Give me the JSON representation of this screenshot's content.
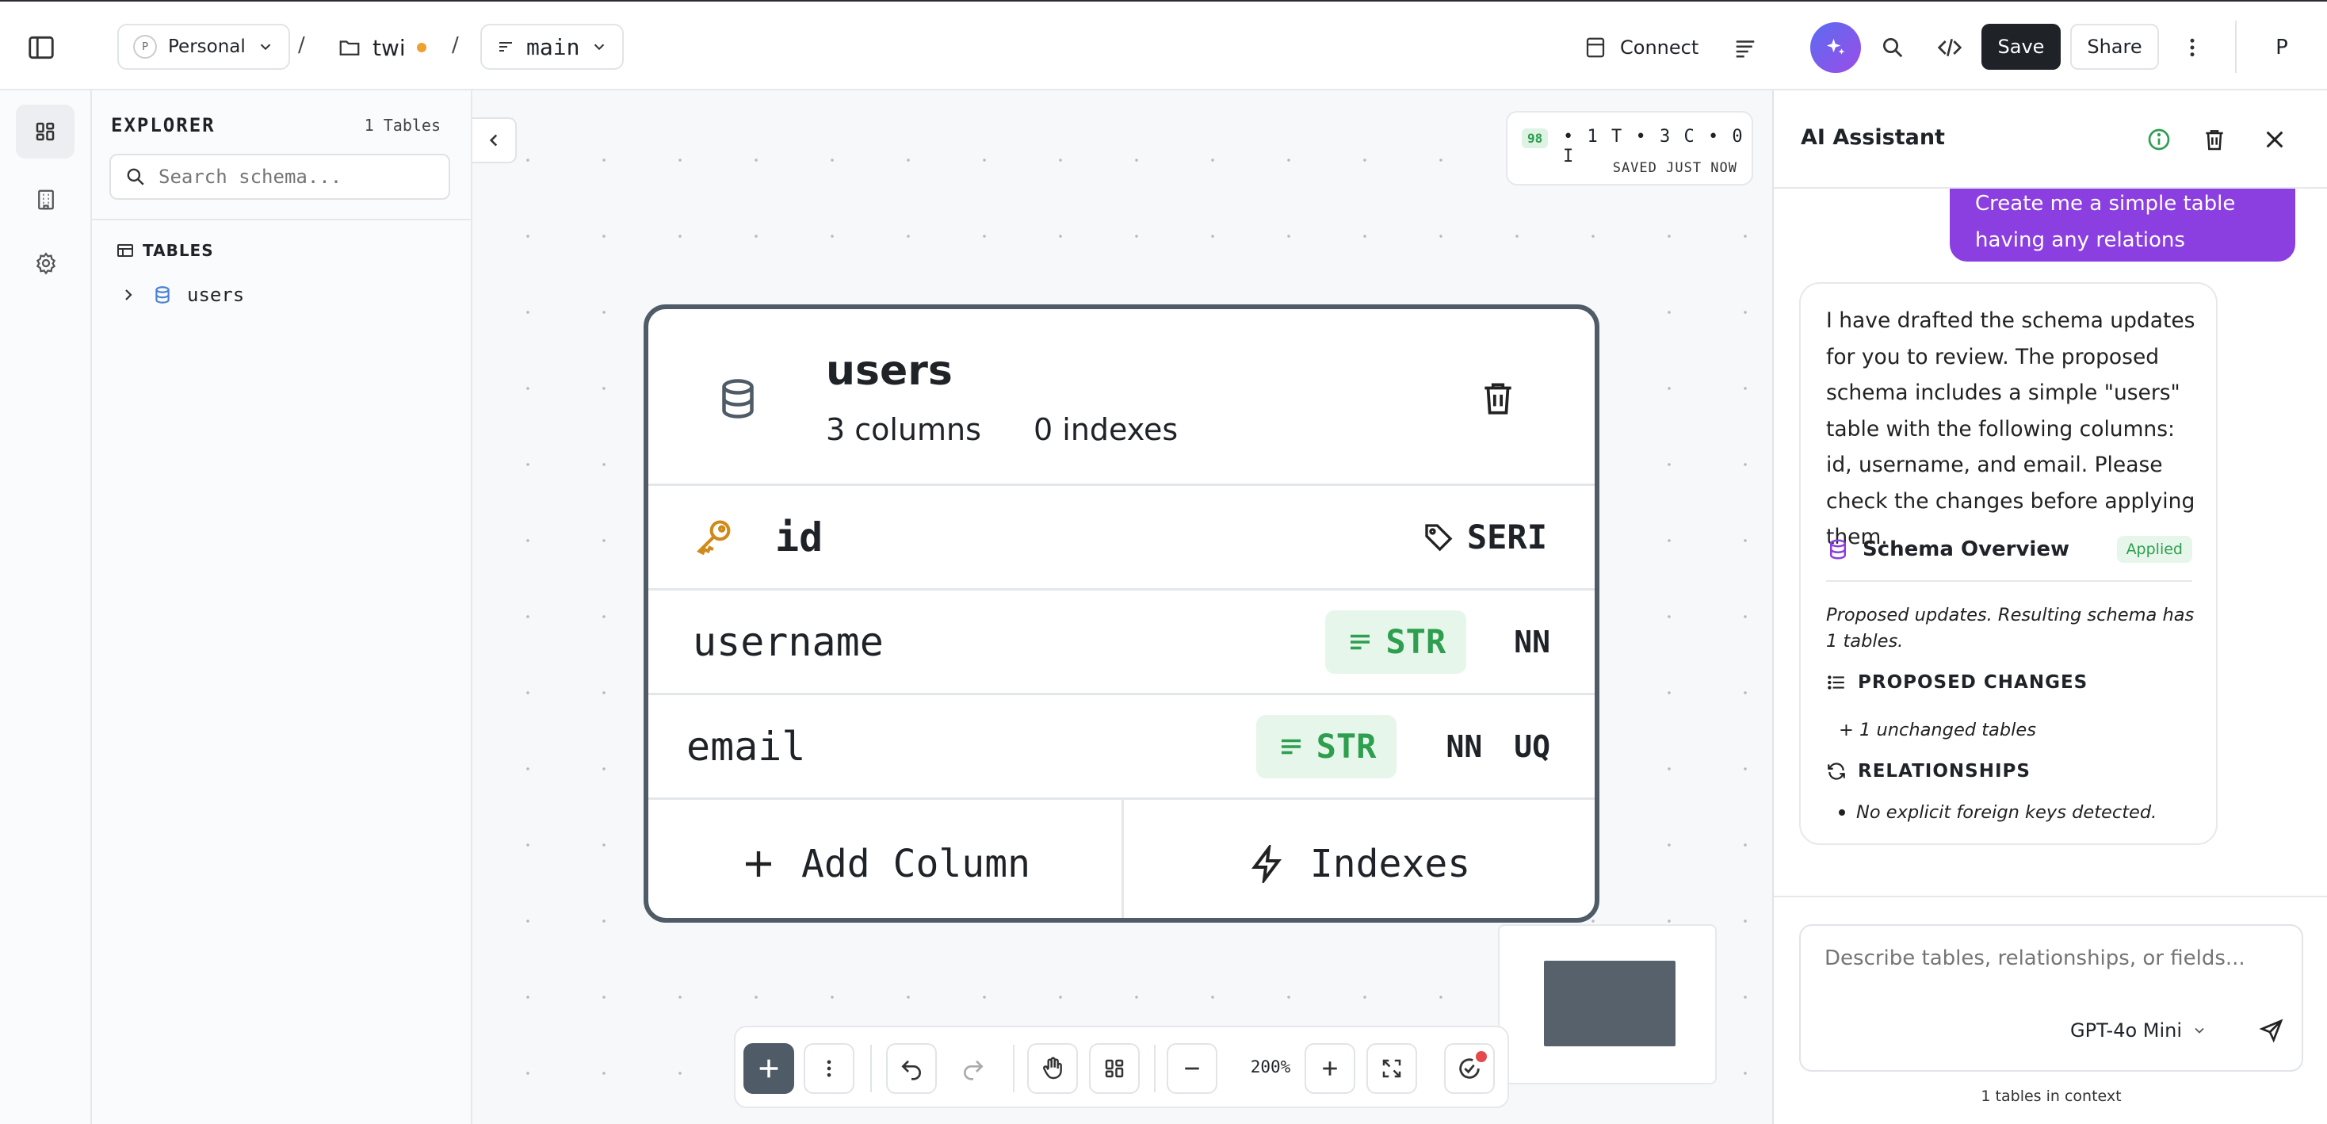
{
  "topbar": {
    "workspace": {
      "avatar": "P",
      "label": "Personal"
    },
    "separator": "/",
    "project": {
      "label": "twi"
    },
    "branch": {
      "label": "main"
    },
    "connect_label": "Connect",
    "save_label": "Save",
    "share_label": "Share",
    "user_initial": "P"
  },
  "explorer": {
    "title": "EXPLORER",
    "count": "1 Tables",
    "search_placeholder": "Search schema...",
    "section_label": "TABLES",
    "tables": [
      {
        "name": "users"
      }
    ]
  },
  "canvas": {
    "status": {
      "badge": "98",
      "summary": "• 1 T • 3 C • 0 I",
      "saved": "SAVED JUST NOW"
    },
    "table": {
      "name": "users",
      "columns_count": "3 columns",
      "indexes_count": "0 indexes",
      "columns": [
        {
          "name": "id",
          "type": "SERI"
        },
        {
          "name": "username",
          "type": "STR",
          "flags": [
            "NN"
          ]
        },
        {
          "name": "email",
          "type": "STR",
          "flags": [
            "NN",
            "UQ"
          ]
        }
      ],
      "add_column_label": "Add Column",
      "indexes_label": "Indexes"
    },
    "toolbar": {
      "zoom": "200%"
    }
  },
  "assistant": {
    "title": "AI Assistant",
    "user_message": "Create me a simple table having any relations",
    "reply": "I have drafted the schema updates for you to review. The proposed schema includes a simple \"users\" table with the following columns: id, username, and email. Please check the changes before applying them.",
    "overview_title": "Schema Overview",
    "overview_badge": "Applied",
    "proposed_note": "Proposed updates. Resulting schema has 1 tables.",
    "proposed_changes_title": "PROPOSED CHANGES",
    "unchanged": "+ 1 unchanged tables",
    "relationships_title": "RELATIONSHIPS",
    "relationships_item": "No explicit foreign keys detected.",
    "input_placeholder": "Describe tables, relationships, or fields...",
    "model": "GPT-4o Mini",
    "context": "1 tables in context"
  },
  "colors": {
    "accent": "#8b3fe0",
    "save_bg": "#1f2328",
    "type_green": "#2e9e4f",
    "card_border": "#4f5b66"
  }
}
